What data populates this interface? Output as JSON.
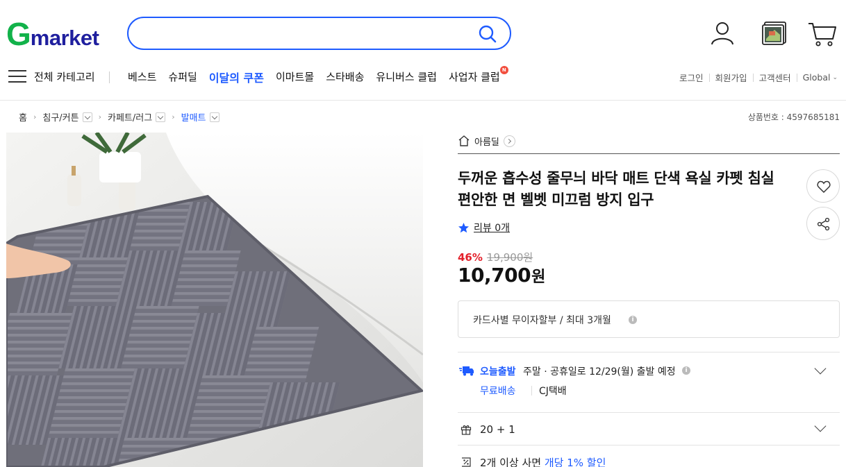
{
  "header": {
    "logo_g": "G",
    "logo_rest": "market",
    "search_placeholder": "",
    "icons": [
      "user-icon",
      "recent-items-icon",
      "cart-icon"
    ]
  },
  "nav": {
    "all_category": "전체 카테고리",
    "menu": [
      "베스트",
      "슈퍼딜",
      "이달의 쿠폰",
      "이마트몰",
      "스타배송",
      "유니버스 클럽",
      "사업자 클럽"
    ],
    "highlight_index": 2,
    "new_badge": "N",
    "util": [
      "로그인",
      "회원가입",
      "고객센터",
      "Global"
    ]
  },
  "breadcrumb": [
    "홈",
    "침구/커튼",
    "카페트/러그",
    "발매트"
  ],
  "product_number": "상품번호 : 4597685181",
  "shop": {
    "name": "아름딜"
  },
  "product": {
    "title": "두꺼운 흡수성 줄무늬 바닥 매트 단색 욕실 카펫 침실 편안한 면 벨벳 미끄럼 방지 입구",
    "review": "리뷰 0개",
    "discount": "46%",
    "original_price": "19,900원",
    "price": "10,700",
    "currency": "원",
    "card": "카드사별 무이자할부 / 최대 3개월",
    "shipping": {
      "today_label": "오늘출발",
      "eta": "주말 · 공휴일로 12/29(월) 출발 예정",
      "free": "무료배송",
      "carrier": "CJ택배"
    },
    "gift": "20 + 1",
    "bulk_prefix": "2개 이상 사면 ",
    "bulk_highlight": "개당 1% 할인"
  },
  "colors": {
    "accent": "#1e5bff",
    "logo_green": "#12b24a",
    "logo_navy": "#1f1f9e",
    "discount_red": "#e3212b",
    "mat_gray": "#6f6f7a"
  },
  "info_glyph": "i"
}
